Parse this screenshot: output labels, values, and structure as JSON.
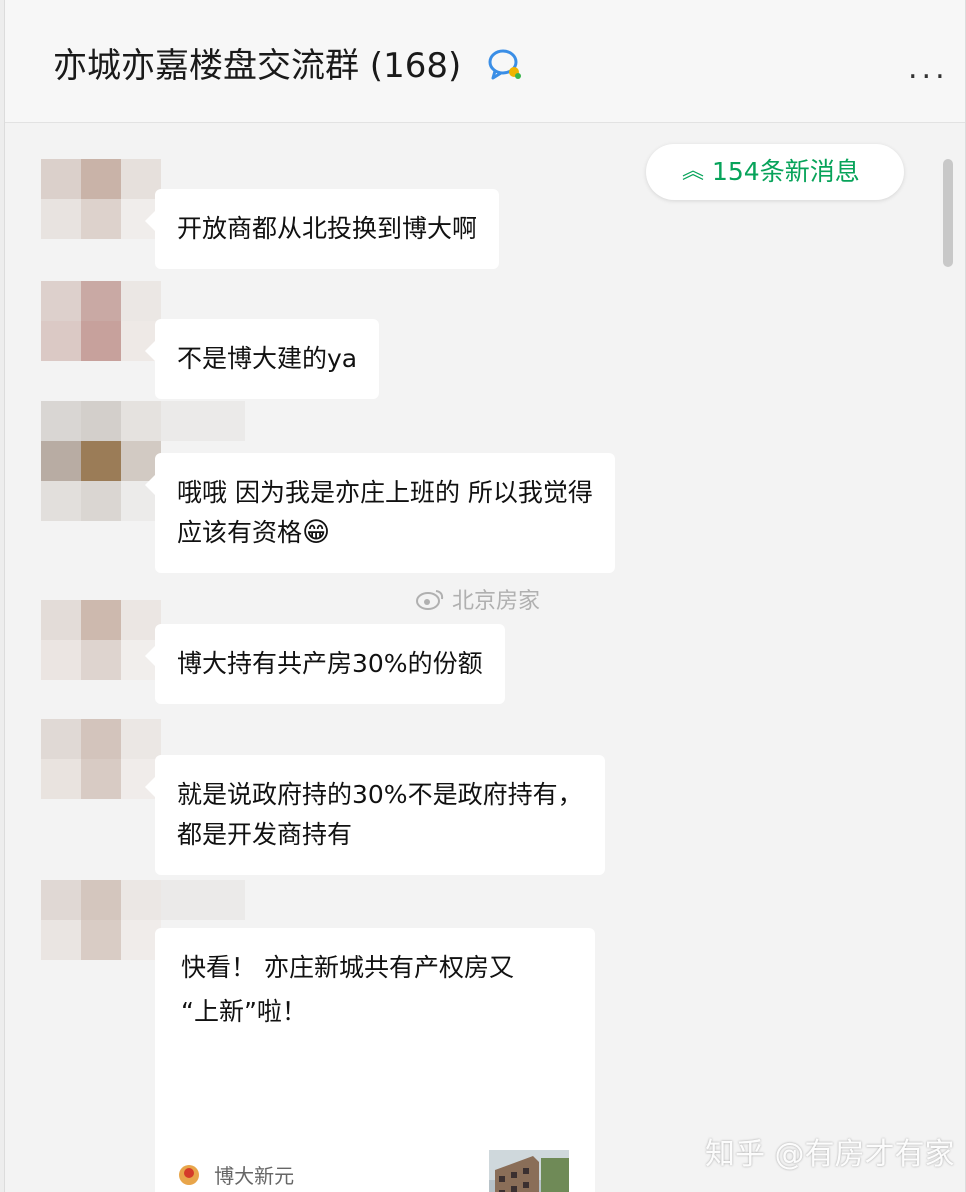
{
  "header": {
    "title": "亦城亦嘉楼盘交流群 (168)",
    "more_label": "..."
  },
  "new_messages": {
    "label": "154条新消息",
    "chevron": "︽"
  },
  "messages": [
    {
      "text": "开放商都从北投换到博大啊"
    },
    {
      "text": "不是博大建的ya"
    },
    {
      "line1": "哦哦 因为我是亦庄上班的 所以我觉得",
      "line2": "应该有资格",
      "emoji": "😁"
    },
    {
      "text": "博大持有共产房30%的份额"
    },
    {
      "line1": "就是说政府持的30%不是政府持有，",
      "line2": "都是开发商持有"
    }
  ],
  "share_card": {
    "line1": "快看！ 亦庄新城共有产权房又",
    "line2": "“上新”啦！",
    "source": "博大新元"
  },
  "watermarks": {
    "center": "北京房家",
    "corner": "知乎 @有房才有家"
  },
  "colors": {
    "accent_green": "#07a35a",
    "bubble_bg": "#ffffff",
    "chat_bg": "#f3f3f3"
  }
}
